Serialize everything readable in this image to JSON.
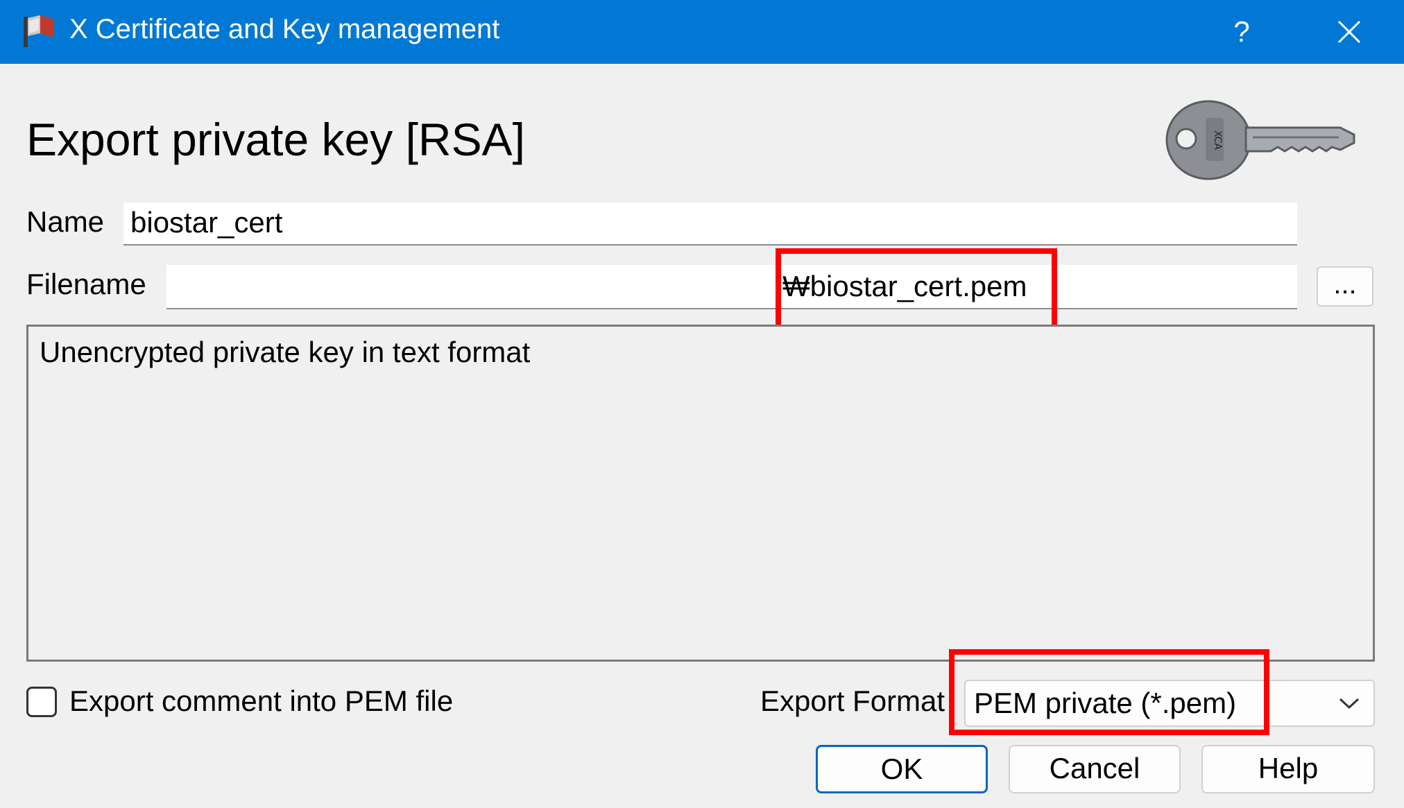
{
  "window": {
    "title": "X Certificate and Key management",
    "help_glyph": "?",
    "close_glyph": "✕",
    "app_icon": "xca-app-icon"
  },
  "dialog": {
    "heading": "Export private key [RSA]",
    "key_image": "key-icon"
  },
  "name": {
    "label": "Name",
    "value": "biostar_cert"
  },
  "filename": {
    "label": "Filename",
    "value": "₩biostar_cert.pem",
    "browse_label": "..."
  },
  "description": {
    "text": "Unencrypted private key in text format"
  },
  "export_comment": {
    "label": "Export comment into PEM file",
    "checked": false
  },
  "export_format": {
    "label": "Export Format",
    "selected": "PEM private (*.pem)"
  },
  "buttons": {
    "ok": "OK",
    "cancel": "Cancel",
    "help": "Help"
  },
  "colors": {
    "titlebar": "#0078d4",
    "highlight": "#ff0000",
    "default_button_border": "#0067c0"
  }
}
